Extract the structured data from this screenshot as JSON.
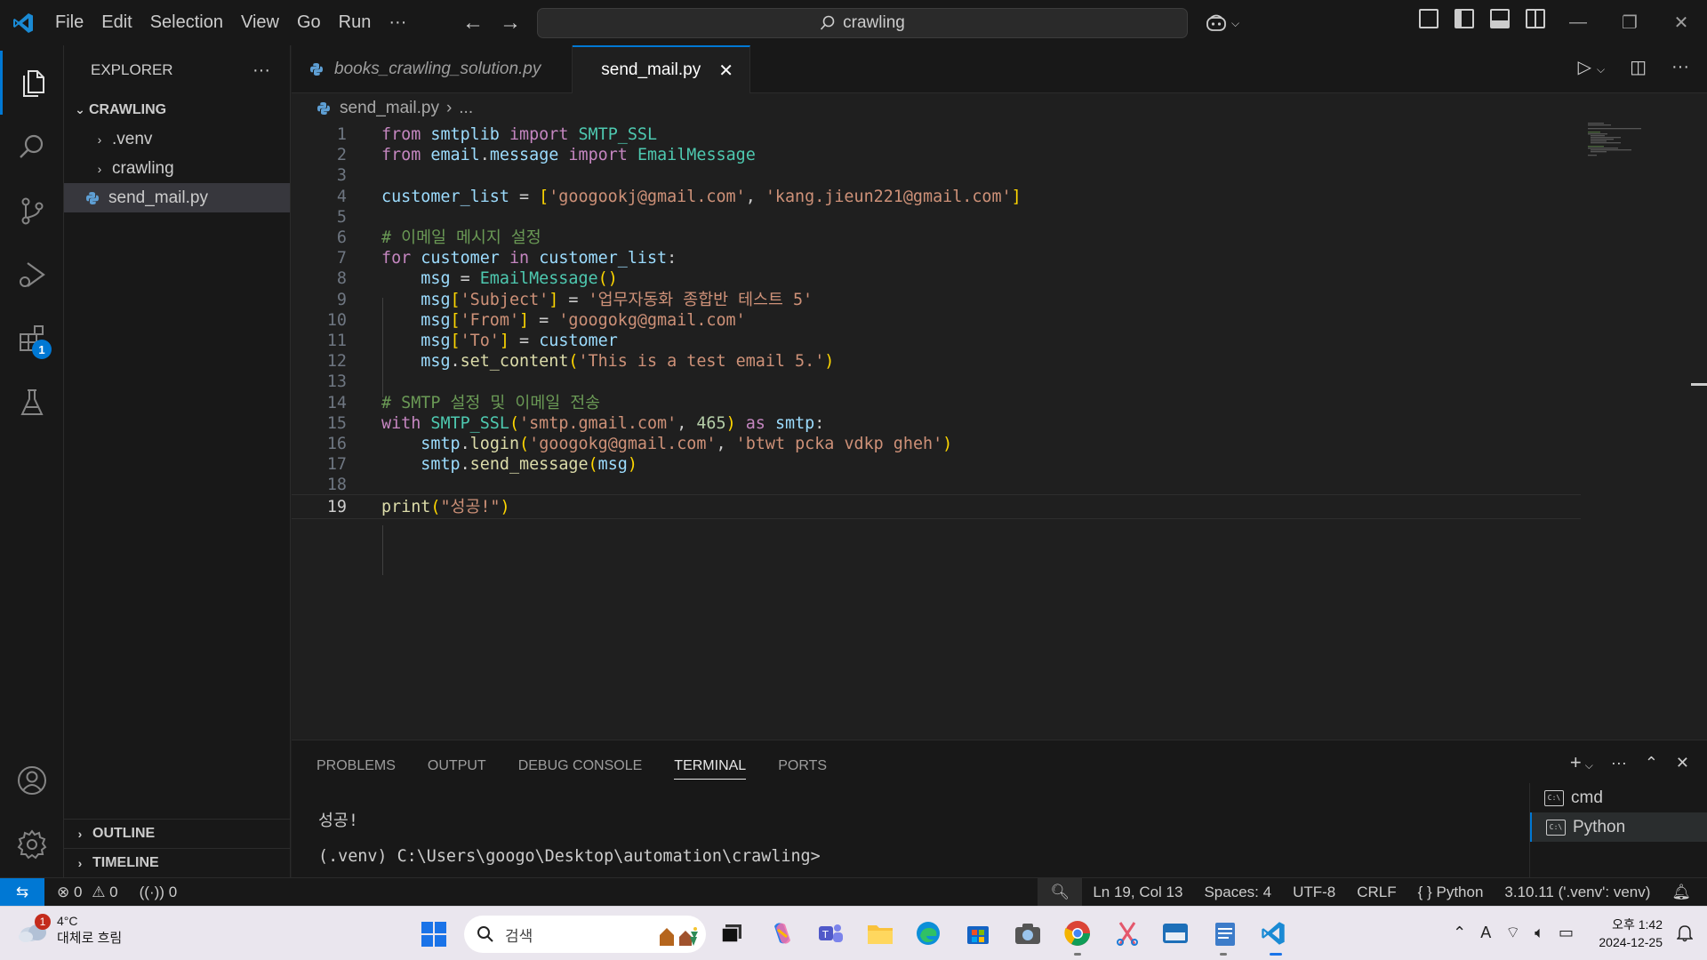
{
  "window": {
    "menu": [
      "File",
      "Edit",
      "Selection",
      "View",
      "Go",
      "Run",
      "···"
    ],
    "search_text": "crawling"
  },
  "sidebar": {
    "title": "EXPLORER",
    "more": "···",
    "root": "CRAWLING",
    "items": [
      {
        "label": ".venv",
        "type": "folder"
      },
      {
        "label": "crawling",
        "type": "folder"
      },
      {
        "label": "send_mail.py",
        "type": "file",
        "selected": true
      }
    ],
    "outline": "OUTLINE",
    "timeline": "TIMELINE"
  },
  "activity": {
    "extensions_badge": "1"
  },
  "tabs": [
    {
      "label": "books_crawling_solution.py",
      "italic": true
    },
    {
      "label": "send_mail.py",
      "active": true
    }
  ],
  "breadcrumb": {
    "file": "send_mail.py",
    "rest": "..."
  },
  "editor": {
    "language": "python",
    "current_line": 19,
    "line_numbers": [
      "1",
      "2",
      "3",
      "4",
      "5",
      "6",
      "7",
      "8",
      "9",
      "10",
      "11",
      "12",
      "13",
      "14",
      "15",
      "16",
      "17",
      "18",
      "19"
    ],
    "lines": [
      "from smtplib import SMTP_SSL",
      "from email.message import EmailMessage",
      "",
      "customer_list = ['googookj@gmail.com', 'kang.jieun221@gmail.com']",
      "",
      "# 이메일 메시지 설정",
      "for customer in customer_list:",
      "    msg = EmailMessage()",
      "    msg['Subject'] = '업무자동화 종합반 테스트 5'",
      "    msg['From'] = 'googokg@gmail.com'",
      "    msg['To'] = customer",
      "    msg.set_content('This is a test email 5.')",
      "",
      "# SMTP 설정 및 이메일 전송",
      "with SMTP_SSL('smtp.gmail.com', 465) as smtp:",
      "    smtp.login('googokg@gmail.com', 'btwt pcka vdkp gheh')",
      "    smtp.send_message(msg)",
      "",
      "print(\"성공!\")"
    ]
  },
  "panel": {
    "tabs": [
      "PROBLEMS",
      "OUTPUT",
      "DEBUG CONSOLE",
      "TERMINAL",
      "PORTS"
    ],
    "active_tab": "TERMINAL",
    "output_lines": [
      "성공!",
      "(.venv) C:\\Users\\googo\\Desktop\\automation\\crawling>"
    ],
    "terminals": [
      {
        "label": "cmd"
      },
      {
        "label": "Python",
        "selected": true
      }
    ]
  },
  "statusbar": {
    "errors": "0",
    "warnings": "0",
    "ports": "0",
    "position": "Ln 19, Col 13",
    "spaces": "Spaces: 4",
    "encoding": "UTF-8",
    "eol": "CRLF",
    "language": "Python",
    "interpreter": "3.10.11 ('.venv': venv)"
  },
  "taskbar": {
    "weather_temp": "4°C",
    "weather_cond": "대체로 흐림",
    "weather_badge": "1",
    "search_placeholder": "검색",
    "time": "오후 1:42",
    "date": "2024-12-25"
  },
  "colors": {
    "accent": "#0078d4",
    "editor_bg": "#1f1f1f",
    "chrome_bg": "#181818",
    "taskbar_bg": "#eae6ee"
  }
}
